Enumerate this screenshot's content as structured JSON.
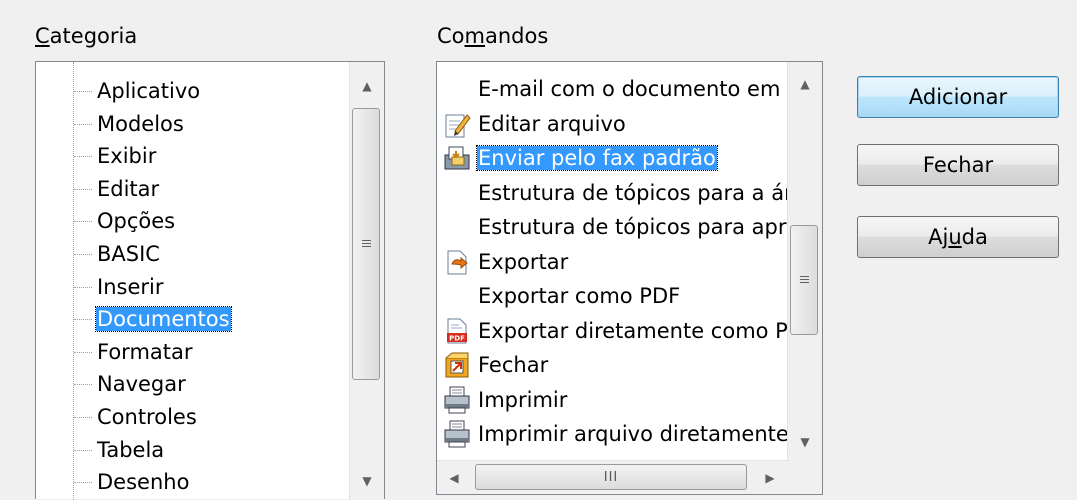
{
  "categoria": {
    "label_pre": "",
    "label_mn": "C",
    "label_post": "ategoria"
  },
  "comandos": {
    "label_pre": "Co",
    "label_mn": "m",
    "label_post": "andos"
  },
  "category_items": [
    {
      "label": "Aplicativo"
    },
    {
      "label": "Modelos"
    },
    {
      "label": "Exibir"
    },
    {
      "label": "Editar"
    },
    {
      "label": "Opções"
    },
    {
      "label": "BASIC"
    },
    {
      "label": "Inserir"
    },
    {
      "label": "Documentos",
      "selected": true
    },
    {
      "label": "Formatar"
    },
    {
      "label": "Navegar"
    },
    {
      "label": "Controles"
    },
    {
      "label": "Tabela"
    },
    {
      "label": "Desenho"
    }
  ],
  "command_items": [
    {
      "label": "E-mail com o documento em anexo",
      "icon": "none"
    },
    {
      "label": "Editar arquivo",
      "icon": "edit-file-icon"
    },
    {
      "label": "Enviar pelo fax padrão",
      "icon": "fax-icon",
      "selected": true
    },
    {
      "label": "Estrutura de tópicos para a área de transferência",
      "icon": "none"
    },
    {
      "label": "Estrutura de tópicos para apresentação",
      "icon": "none"
    },
    {
      "label": "Exportar",
      "icon": "export-icon"
    },
    {
      "label": "Exportar como PDF",
      "icon": "none"
    },
    {
      "label": "Exportar diretamente como PDF",
      "icon": "pdf-icon"
    },
    {
      "label": "Fechar",
      "icon": "close-doc-icon"
    },
    {
      "label": "Imprimir",
      "icon": "printer-icon"
    },
    {
      "label": "Imprimir arquivo diretamente",
      "icon": "printer-icon"
    }
  ],
  "buttons": {
    "adicionar": "Adicionar",
    "fechar": "Fechar",
    "ajuda_pre": "Aj",
    "ajuda_mn": "u",
    "ajuda_post": "da"
  },
  "hscroll_grip": "III",
  "colors": {
    "selection": "#3399ff",
    "background": "#f0f0f0"
  }
}
